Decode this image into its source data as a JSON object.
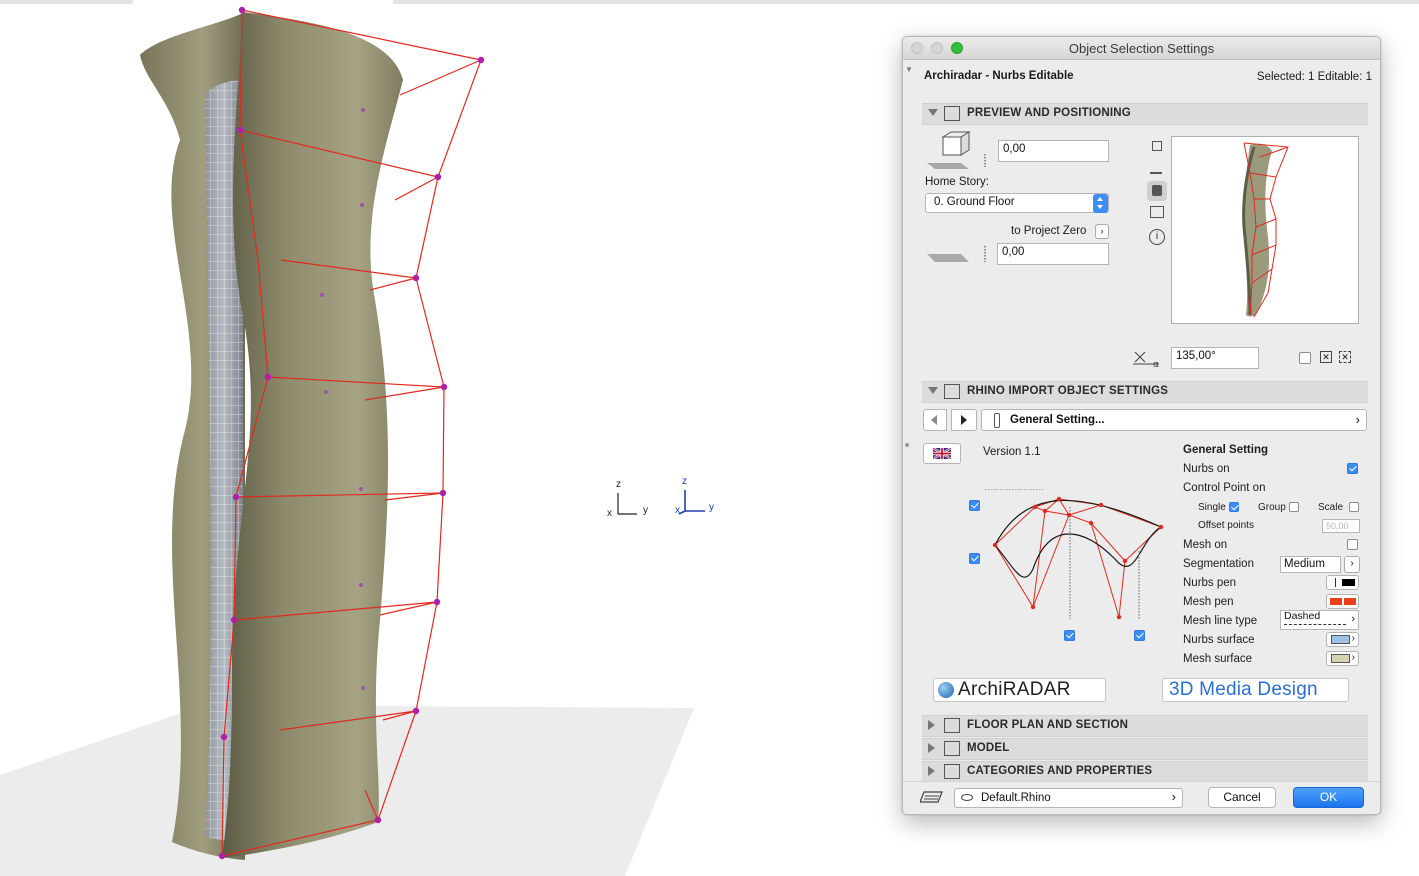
{
  "dialog": {
    "title": "Object Selection Settings",
    "object_name": "Archiradar - Nurbs Editable",
    "selection_info": "Selected: 1 Editable: 1"
  },
  "preview": {
    "header": "PREVIEW AND POSITIONING",
    "elevation_value": "0,00",
    "home_story_label": "Home Story:",
    "home_story_value": "0. Ground Floor",
    "to_project_zero_label": "to Project Zero",
    "project_zero_value": "0,00",
    "angle_value": "135,00°"
  },
  "rhino": {
    "header": "RHINO IMPORT OBJECT SETTINGS",
    "setting_page": "General Setting...",
    "version": "Version 1.1",
    "general_title": "General Setting",
    "nurbs_on_label": "Nurbs on",
    "nurbs_on": true,
    "control_point_label": "Control Point on",
    "single_label": "Single",
    "single": true,
    "group_label": "Group",
    "group": false,
    "scale_label": "Scale",
    "scale": false,
    "offset_label": "Offset points",
    "offset_value": "50,00",
    "mesh_on_label": "Mesh on",
    "mesh_on": false,
    "segmentation_label": "Segmentation",
    "segmentation_value": "Medium",
    "nurbs_pen_label": "Nurbs pen",
    "mesh_pen_label": "Mesh pen",
    "mesh_line_type_label": "Mesh line type",
    "mesh_line_type_value": "Dashed",
    "nurbs_surface_label": "Nurbs surface",
    "mesh_surface_label": "Mesh surface",
    "logo_left": "ArchiRADAR",
    "logo_right": "3D Media Design",
    "colors": {
      "nurbs_pen": "#000000",
      "mesh_pen": "#e8401c",
      "nurbs_surface": "#9cc3e6",
      "mesh_surface": "#d6d3b2"
    }
  },
  "sections": {
    "floor_plan": "FLOOR PLAN AND SECTION",
    "model": "MODEL",
    "categories": "CATEGORIES AND PROPERTIES"
  },
  "footer": {
    "favorite": "Default.Rhino",
    "cancel": "Cancel",
    "ok": "OK"
  },
  "axes": {
    "z": "z",
    "x": "x",
    "y": "y"
  }
}
